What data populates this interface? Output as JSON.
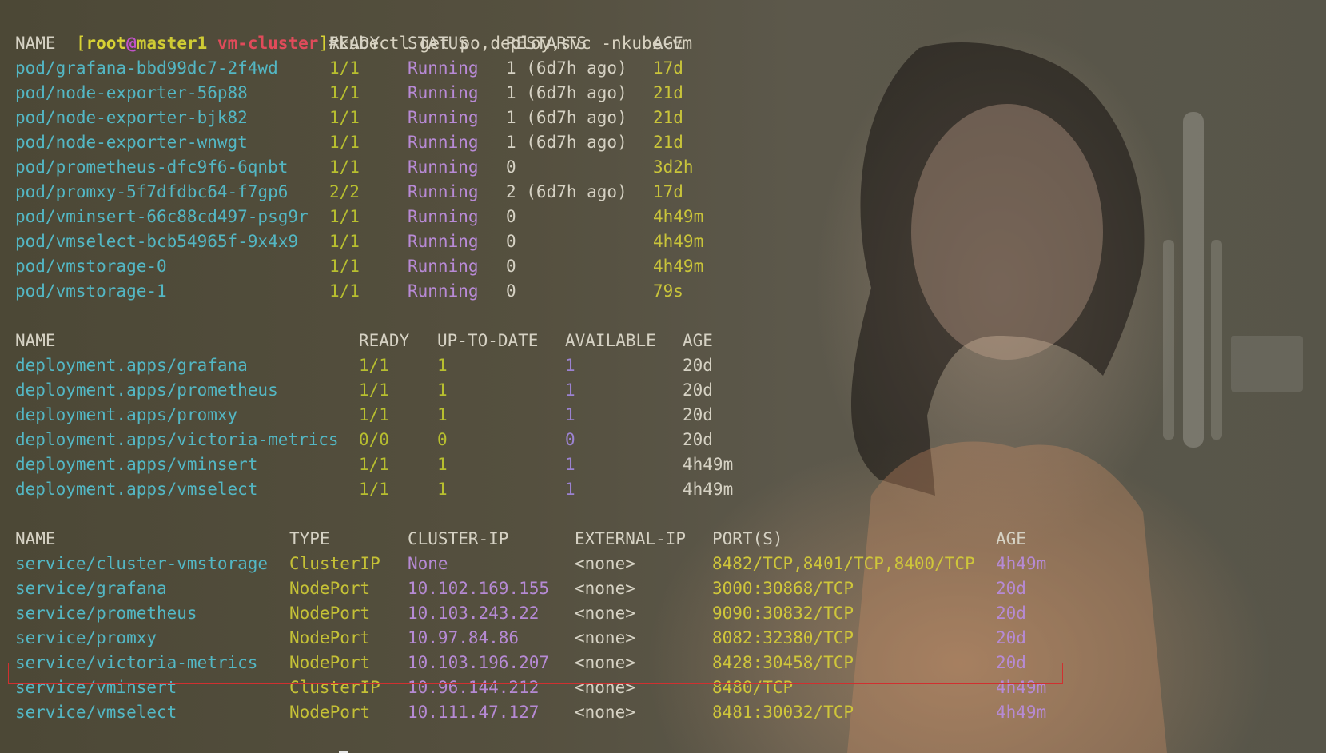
{
  "prompt": {
    "user": "root",
    "at": "@",
    "host": "master1",
    "dir": "vm-cluster",
    "hash": "#"
  },
  "command": "kubectl get po,deploy,svc -nkube-vm",
  "pods": {
    "headers": [
      "NAME",
      "READY",
      "STATUS",
      "RESTARTS",
      "AGE"
    ],
    "rows": [
      [
        "pod/grafana-bbd99dc7-2f4wd",
        "1/1",
        "Running",
        "1 (6d7h ago)",
        "17d"
      ],
      [
        "pod/node-exporter-56p88",
        "1/1",
        "Running",
        "1 (6d7h ago)",
        "21d"
      ],
      [
        "pod/node-exporter-bjk82",
        "1/1",
        "Running",
        "1 (6d7h ago)",
        "21d"
      ],
      [
        "pod/node-exporter-wnwgt",
        "1/1",
        "Running",
        "1 (6d7h ago)",
        "21d"
      ],
      [
        "pod/prometheus-dfc9f6-6qnbt",
        "1/1",
        "Running",
        "0",
        "3d2h"
      ],
      [
        "pod/promxy-5f7dfdbc64-f7gp6",
        "2/2",
        "Running",
        "2 (6d7h ago)",
        "17d"
      ],
      [
        "pod/vminsert-66c88cd497-psg9r",
        "1/1",
        "Running",
        "0",
        "4h49m"
      ],
      [
        "pod/vmselect-bcb54965f-9x4x9",
        "1/1",
        "Running",
        "0",
        "4h49m"
      ],
      [
        "pod/vmstorage-0",
        "1/1",
        "Running",
        "0",
        "4h49m"
      ],
      [
        "pod/vmstorage-1",
        "1/1",
        "Running",
        "0",
        "79s"
      ]
    ]
  },
  "deployments": {
    "headers": [
      "NAME",
      "READY",
      "UP-TO-DATE",
      "AVAILABLE",
      "AGE"
    ],
    "rows": [
      [
        "deployment.apps/grafana",
        "1/1",
        "1",
        "1",
        "20d"
      ],
      [
        "deployment.apps/prometheus",
        "1/1",
        "1",
        "1",
        "20d"
      ],
      [
        "deployment.apps/promxy",
        "1/1",
        "1",
        "1",
        "20d"
      ],
      [
        "deployment.apps/victoria-metrics",
        "0/0",
        "0",
        "0",
        "20d"
      ],
      [
        "deployment.apps/vminsert",
        "1/1",
        "1",
        "1",
        "4h49m"
      ],
      [
        "deployment.apps/vmselect",
        "1/1",
        "1",
        "1",
        "4h49m"
      ]
    ]
  },
  "services": {
    "headers": [
      "NAME",
      "TYPE",
      "CLUSTER-IP",
      "EXTERNAL-IP",
      "PORT(S)",
      "AGE"
    ],
    "rows": [
      [
        "service/cluster-vmstorage",
        "ClusterIP",
        "None",
        "<none>",
        "8482/TCP,8401/TCP,8400/TCP",
        "4h49m"
      ],
      [
        "service/grafana",
        "NodePort",
        "10.102.169.155",
        "<none>",
        "3000:30868/TCP",
        "20d"
      ],
      [
        "service/prometheus",
        "NodePort",
        "10.103.243.22",
        "<none>",
        "9090:30832/TCP",
        "20d"
      ],
      [
        "service/promxy",
        "NodePort",
        "10.97.84.86",
        "<none>",
        "8082:32380/TCP",
        "20d"
      ],
      [
        "service/victoria-metrics",
        "NodePort",
        "10.103.196.207",
        "<none>",
        "8428:30458/TCP",
        "20d"
      ],
      [
        "service/vminsert",
        "ClusterIP",
        "10.96.144.212",
        "<none>",
        "8480/TCP",
        "4h49m"
      ],
      [
        "service/vmselect",
        "NodePort",
        "10.111.47.127",
        "<none>",
        "8481:30032/TCP",
        "4h49m"
      ]
    ]
  },
  "colors": {
    "name": "#53b7c4",
    "ready": "#b8bf2f",
    "status": "#b88ad6",
    "age": "#c9c43a",
    "type": "#c5c136",
    "ip": "#b68ad4",
    "port": "#cfc63a",
    "highlight_border": "#d03030"
  }
}
